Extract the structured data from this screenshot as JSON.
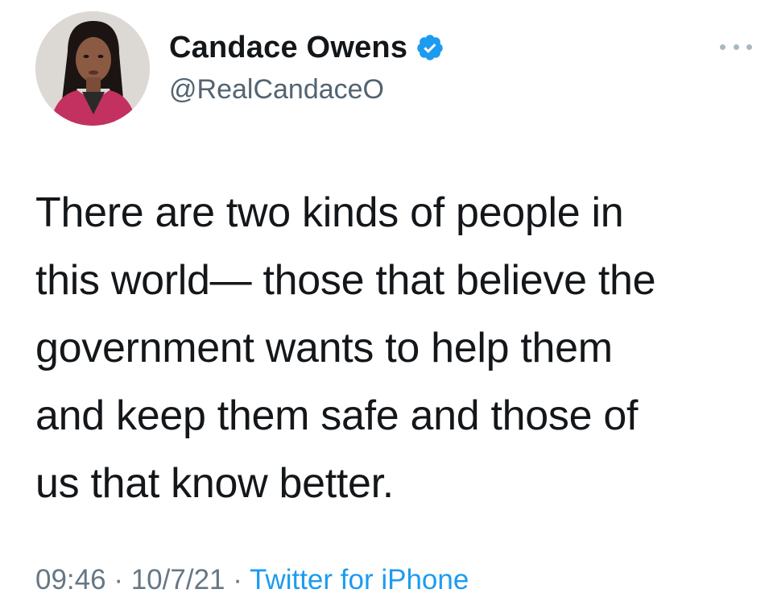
{
  "author": {
    "display_name": "Candace Owens",
    "handle": "@RealCandaceO",
    "verified": true,
    "verified_icon": "verified-badge-icon"
  },
  "tweet": {
    "lines": [
      "There are two kinds of people in",
      "this world— those that believe the",
      "government wants to help them",
      "and keep them safe and those of",
      "us that know better."
    ]
  },
  "meta": {
    "time": "09:46",
    "separator": "·",
    "date": "10/7/21",
    "source": "Twitter for iPhone"
  },
  "colors": {
    "accent": "#1d9bf0",
    "verified": "#1d9bf0",
    "text": "#14171a",
    "secondary": "#657786"
  }
}
